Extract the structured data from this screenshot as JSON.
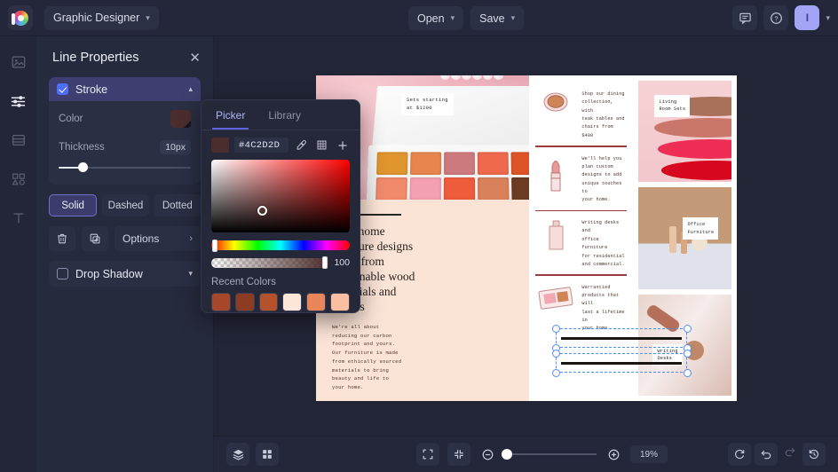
{
  "app": {
    "title": "Graphic Designer",
    "logo_icon": "color-wheel-logo",
    "open_label": "Open",
    "save_label": "Save",
    "comment_icon": "comment-icon",
    "help_icon": "help-icon",
    "avatar_initial": "I",
    "avatar_color": "#a3a4f5"
  },
  "rail": {
    "items": [
      {
        "name": "image-tool",
        "icon": "image-icon"
      },
      {
        "name": "adjustments-tool",
        "icon": "sliders-icon",
        "active": true
      },
      {
        "name": "layout-tool",
        "icon": "layout-icon"
      },
      {
        "name": "shapes-tool",
        "icon": "shapes-icon"
      },
      {
        "name": "text-tool",
        "icon": "text-icon"
      }
    ]
  },
  "panel": {
    "title": "Line Properties",
    "close_icon": "close-icon",
    "stroke": {
      "label": "Stroke",
      "checked": true,
      "color_label": "Color",
      "color_value": "#4C2D2D",
      "thickness_label": "Thickness",
      "thickness_value": "10px",
      "thickness_percent": 18
    },
    "styles": [
      {
        "label": "Solid",
        "active": true
      },
      {
        "label": "Dashed",
        "active": false
      },
      {
        "label": "Dotted",
        "active": false
      }
    ],
    "actions": {
      "delete_icon": "trash-icon",
      "duplicate_icon": "duplicate-icon",
      "options_label": "Options",
      "options_chevron": "chevron-right-icon"
    },
    "drop_shadow": {
      "label": "Drop Shadow",
      "checked": false,
      "caret": "chevron-down-icon"
    }
  },
  "picker": {
    "tabs": [
      {
        "label": "Picker",
        "active": true
      },
      {
        "label": "Library",
        "active": false
      }
    ],
    "hex": "#4C2D2D",
    "eyedropper_icon": "eyedropper-icon",
    "grid_icon": "grid-icon",
    "add_icon": "plus-icon",
    "alpha_value": "100",
    "recent_label": "Recent Colors",
    "recent_colors": [
      "#a8482a",
      "#8c3c22",
      "#b4522c",
      "#fce7d8",
      "#e8855a",
      "#f9bfa0"
    ]
  },
  "canvas": {
    "top_tag": "Sets starting\nat $1200",
    "headline": "from home\nfurniture designs\nmade from\nsustainable wood\nmaterials and\nfabrics",
    "body": "We're all about\nreducing our carbon\nfootprint and yours.\nOur furniture is made\nfrom ethically sourced\nmaterials to bring\nbeauty and life to\nyour home.",
    "mid_items": [
      {
        "text": "Shop our dining\ncollection, with\nteak tables and\nchairs from $400",
        "art": "compact-powder-illustration"
      },
      {
        "text": "We'll help you\nplan custom\ndesigns to add\nunique touches to\nyour home.",
        "art": "lipstick-illustration"
      },
      {
        "text": "Writing desks and\noffice furniture\nfor residential\nand commercial.",
        "art": "bottle-illustration"
      },
      {
        "text": "Warrantied\nproducts that will\nlast a lifetime in\nyour home.",
        "art": "blush-palette-illustration"
      }
    ],
    "cards": [
      {
        "tag": "Living\nRoom Sets",
        "art": "lipstick-swatches-photo"
      },
      {
        "tag": "Office\nFurniture",
        "art": "makeup-products-photo"
      },
      {
        "tag": "Writing\nDesks",
        "art": "rose-gold-products-photo"
      }
    ]
  },
  "bottombar": {
    "layers_icon": "layers-icon",
    "grid_icon": "grid-view-icon",
    "fullscreen_icon": "fullscreen-icon",
    "fit_icon": "fit-to-screen-icon",
    "zoom_out_icon": "zoom-out-icon",
    "zoom_in_icon": "zoom-in-icon",
    "zoom_value": "19%",
    "zoom_percent": 2,
    "refresh_icon": "refresh-icon",
    "undo_icon": "undo-icon",
    "redo_icon": "redo-icon",
    "history_icon": "history-icon"
  }
}
